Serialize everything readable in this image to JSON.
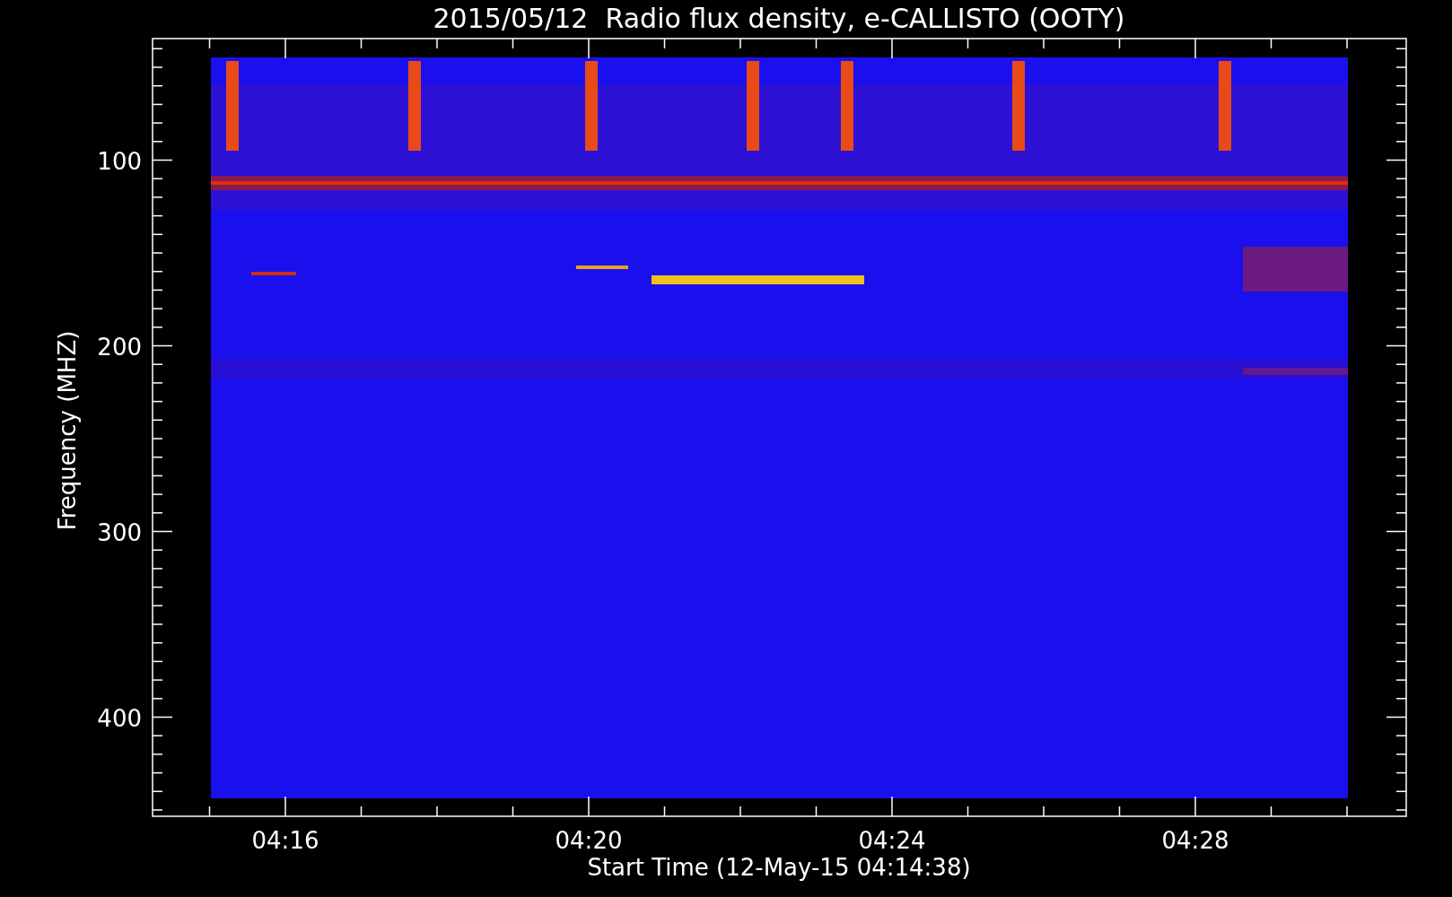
{
  "title": "2015/05/12  Radio flux density, e-CALLISTO (OOTY)",
  "y_axis": {
    "label": "Frequency (MHZ)",
    "ticks": [
      "100",
      "200",
      "300",
      "400"
    ]
  },
  "x_axis": {
    "label": "Start Time (12-May-15 04:14:38)",
    "ticks": [
      "04:16",
      "04:20",
      "04:24",
      "04:28"
    ]
  }
}
